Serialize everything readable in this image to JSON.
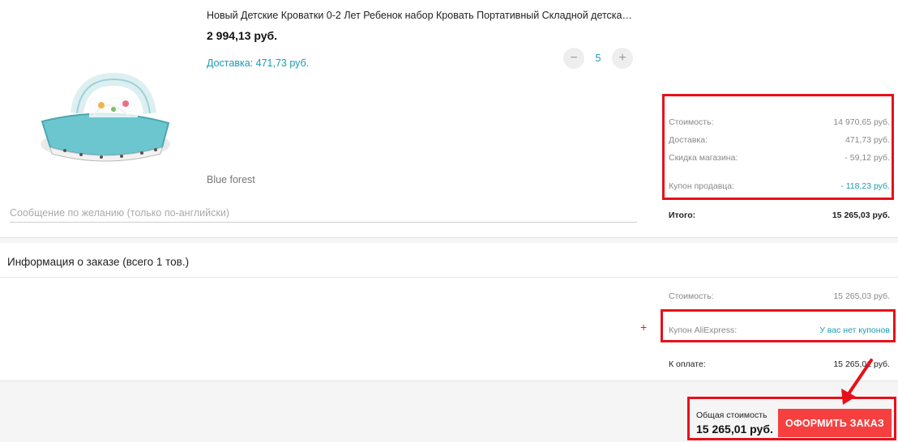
{
  "product": {
    "title": "Новый Детские Кроватки 0-2 Лет Ребенок набор Кровать Портативный Складной детска…",
    "price": "2 994,13 руб.",
    "shipping": "Доставка: 471,73 руб.",
    "quantity": "5",
    "minus_symbol": "−",
    "plus_symbol": "+",
    "variant": "Blue forest",
    "message_placeholder": "Сообщение по желанию (только по-английски)"
  },
  "seller_summary": {
    "cost_label": "Стоимость:",
    "cost_value": "14 970,65 руб.",
    "delivery_label": "Доставка:",
    "delivery_value": "471,73 руб.",
    "discount_label": "Скидка магазина:",
    "discount_value": "- 59,12 руб.",
    "coupon_label": "Купон продавца:",
    "coupon_value": "- 118,23 руб.",
    "total_label": "Итого:",
    "total_value": "15 265,03 руб."
  },
  "order_info": {
    "heading": "Информация о заказе (всего 1 тов.)",
    "cost_label": "Стоимость:",
    "cost_value": "15 265,03 руб.",
    "plus_mark": "+",
    "ae_coupon_label": "Купон AliExpress:",
    "ae_coupon_value": "У вас нет купонов",
    "pay_label": "К оплате:",
    "pay_value": "15 265,01 руб."
  },
  "footer": {
    "total_label": "Общая стоимость",
    "total_value": "15 265,01 руб.",
    "checkout_label": "ОФОРМИТЬ ЗАКАЗ"
  },
  "colors": {
    "accent": "#1a9bb5",
    "checkout": "#f6403f",
    "annotation": "#e8101a"
  }
}
